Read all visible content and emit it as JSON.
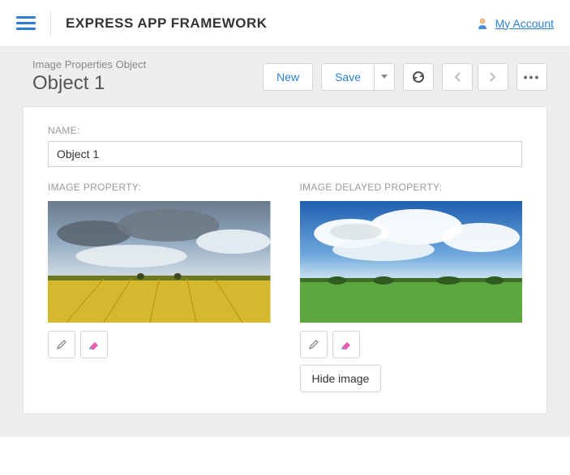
{
  "header": {
    "brand": "EXPRESS APP FRAMEWORK",
    "account_link": "My Account"
  },
  "subheader": {
    "breadcrumb": "Image Properties Object",
    "title": "Object 1"
  },
  "toolbar": {
    "new_label": "New",
    "save_label": "Save"
  },
  "form": {
    "name_label": "NAME:",
    "name_value": "Object 1",
    "image_property_label": "IMAGE PROPERTY:",
    "image_delayed_label": "IMAGE DELAYED PROPERTY:",
    "hide_image_label": "Hide image"
  }
}
